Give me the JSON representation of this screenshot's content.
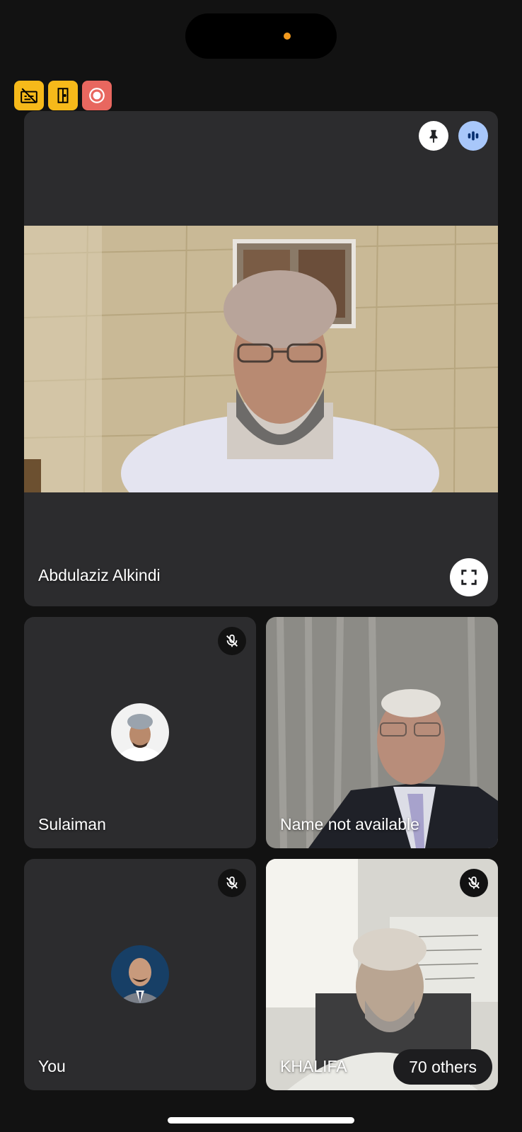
{
  "status": {
    "camera_indicator_color": "#f39a1e"
  },
  "indicators": [
    {
      "icon": "captions-off-icon",
      "color": "#f6b91a"
    },
    {
      "icon": "door-icon",
      "color": "#f6b91a"
    },
    {
      "icon": "recording-icon",
      "color": "#e8675f"
    }
  ],
  "main_tile": {
    "name": "Abdulaziz Alkindi",
    "icons": [
      "pin-icon",
      "audio-level-icon",
      "fullscreen-icon"
    ]
  },
  "participants": [
    {
      "name": "Sulaiman",
      "muted": true,
      "video": false
    },
    {
      "name": "Name not available",
      "muted": false,
      "video": true
    },
    {
      "name": "You",
      "muted": true,
      "video": false
    },
    {
      "name": "KHALIFA",
      "muted": true,
      "video": true
    }
  ],
  "others_label": "70 others",
  "colors": {
    "background": "#121212",
    "tile": "#2c2c2e",
    "speaking": "#a8c7fa",
    "indicator_yellow": "#f6b91a",
    "indicator_red": "#e8675f"
  }
}
